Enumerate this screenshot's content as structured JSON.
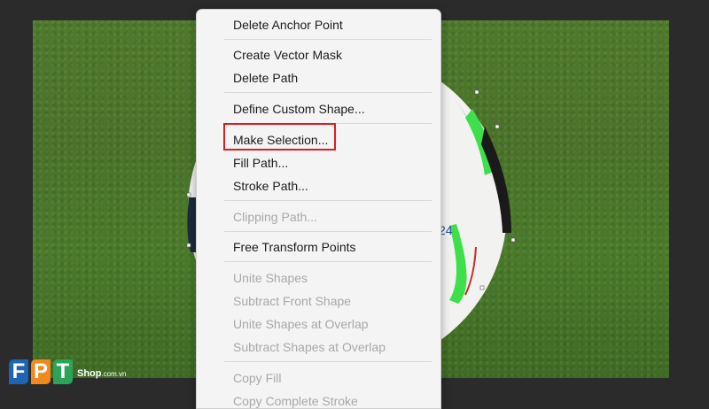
{
  "menu": {
    "items": [
      {
        "label": "Delete Anchor Point",
        "enabled": true
      },
      {
        "label": "Create Vector Mask",
        "enabled": true
      },
      {
        "label": "Delete Path",
        "enabled": true
      },
      {
        "label": "Define Custom Shape...",
        "enabled": true
      },
      {
        "label": "Make Selection...",
        "enabled": true,
        "highlighted": true
      },
      {
        "label": "Fill Path...",
        "enabled": true
      },
      {
        "label": "Stroke Path...",
        "enabled": true
      },
      {
        "label": "Clipping Path...",
        "enabled": false
      },
      {
        "label": "Free Transform Points",
        "enabled": true
      },
      {
        "label": "Unite Shapes",
        "enabled": false
      },
      {
        "label": "Subtract Front Shape",
        "enabled": false
      },
      {
        "label": "Unite Shapes at Overlap",
        "enabled": false
      },
      {
        "label": "Subtract Shapes at Overlap",
        "enabled": false
      },
      {
        "label": "Copy Fill",
        "enabled": false
      },
      {
        "label": "Copy Complete Stroke",
        "enabled": false
      }
    ],
    "highlight_color": "#d91f26"
  },
  "logo": {
    "letters": [
      "F",
      "P",
      "T"
    ],
    "shop": "Shop",
    "domain": ".com.vn",
    "colors": [
      "#1e64b4",
      "#f08a1c",
      "#2ba45a"
    ]
  },
  "canvas": {
    "ball_number": "24",
    "colors": {
      "grass": "#4a7329",
      "ball_accent": "#3de04a"
    }
  }
}
